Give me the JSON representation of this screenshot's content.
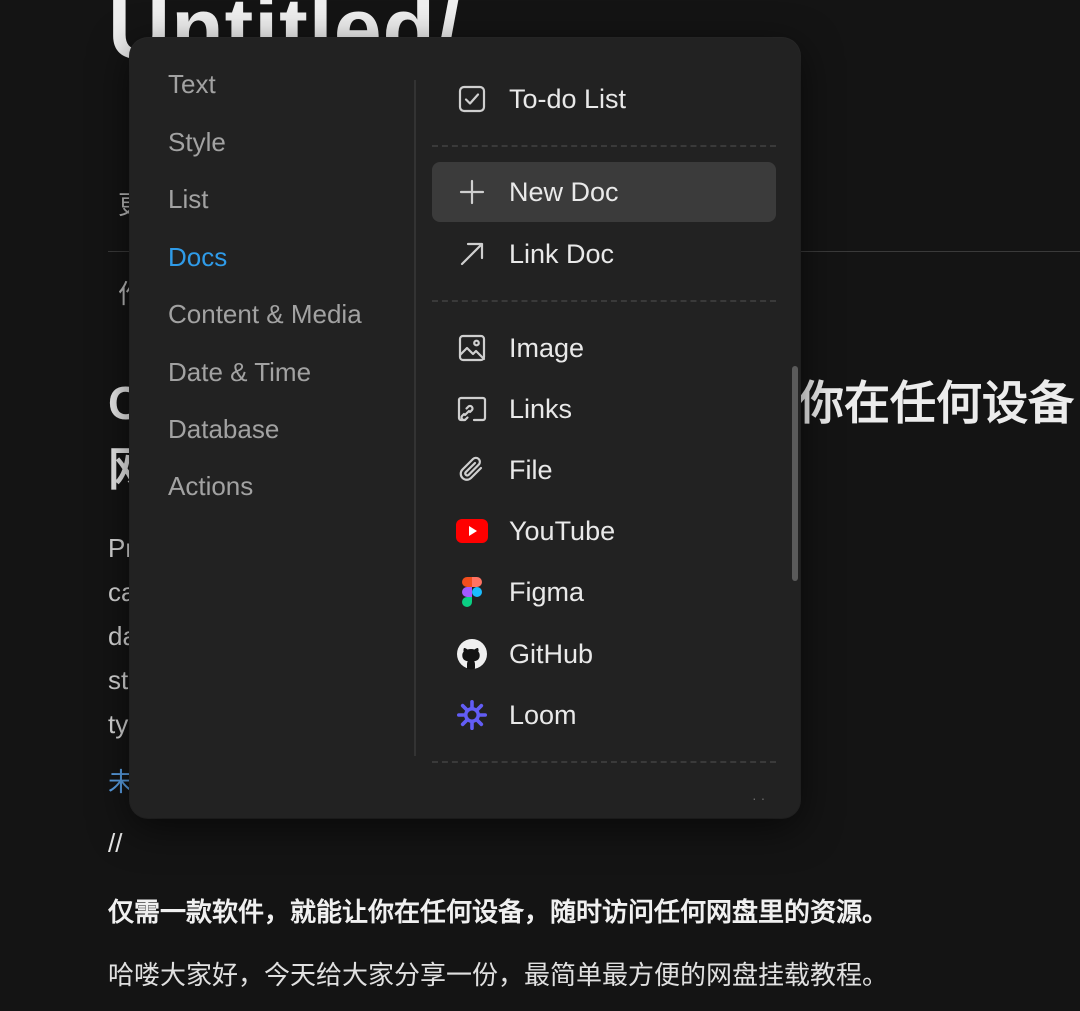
{
  "document": {
    "title": "Untitled/",
    "meta_line": "更",
    "meta_line_2": "作",
    "heading_line1_left": "C",
    "heading_line1_right": "你在任何设备",
    "heading_line2_left": "网",
    "body_lines": [
      "Pr",
      "ca",
      "da",
      "st",
      "ty"
    ],
    "link_text": "未",
    "slash": "//",
    "bold_paragraph": "仅需一款软件，就能让你在任何设备，随时访问任何网盘里的资源。",
    "paragraph": "哈喽大家好，今天给大家分享一份，最简单最方便的网盘挂载教程。"
  },
  "slash_menu": {
    "categories": [
      {
        "label": "Text"
      },
      {
        "label": "Style"
      },
      {
        "label": "List"
      },
      {
        "label": "Docs",
        "active": true
      },
      {
        "label": "Content & Media"
      },
      {
        "label": "Date & Time"
      },
      {
        "label": "Database"
      },
      {
        "label": "Actions"
      }
    ],
    "options": [
      {
        "label": "To-do List",
        "icon": "checkbox-icon"
      },
      {
        "label": "New Doc",
        "icon": "plus-icon",
        "highlighted": true
      },
      {
        "label": "Link Doc",
        "icon": "arrow-up-right-icon"
      },
      {
        "label": "Image",
        "icon": "image-icon"
      },
      {
        "label": "Links",
        "icon": "link-card-icon"
      },
      {
        "label": "File",
        "icon": "paperclip-icon"
      },
      {
        "label": "YouTube",
        "icon": "youtube-icon"
      },
      {
        "label": "Figma",
        "icon": "figma-icon"
      },
      {
        "label": "GitHub",
        "icon": "github-icon"
      },
      {
        "label": "Loom",
        "icon": "loom-icon"
      }
    ]
  },
  "colors": {
    "accent": "#2f9be8",
    "youtube": "#ff0000",
    "loom": "#625df5"
  }
}
